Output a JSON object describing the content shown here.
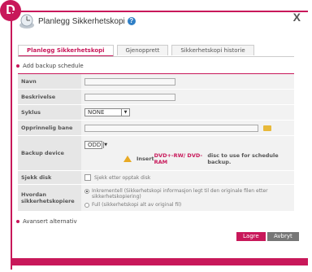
{
  "badge": "D",
  "dialog": {
    "title": "Planlegg Sikkerhetskopi",
    "help_icon": "?",
    "close_icon": "X"
  },
  "tabs": [
    {
      "label": "Planlegg Sikkerhetskopi",
      "active": true
    },
    {
      "label": "Gjenopprett",
      "active": false
    },
    {
      "label": "Sikkerhetskopi historie",
      "active": false
    }
  ],
  "section_add": "Add backup schedule",
  "fields": {
    "navn": {
      "label": "Navn",
      "value": ""
    },
    "beskrivelse": {
      "label": "Beskrivelse",
      "value": ""
    },
    "syklus": {
      "label": "Syklus",
      "value": "NONE"
    },
    "opprinnelig": {
      "label": "Opprinnelig bane",
      "value": ""
    },
    "backup_device": {
      "label": "Backup device",
      "value": "ODD",
      "warning_prefix": "Insert ",
      "warning_media": "DVD+-RW/ DVD-RAM",
      "warning_suffix": " disc to use for schedule backup."
    },
    "sjekk_disk": {
      "label": "Sjekk disk",
      "option": "Sjekk etter opptak disk",
      "checked": false
    },
    "hvordan": {
      "label": "Hvordan sikkerhetskopiere",
      "options": [
        {
          "text": "Inkrementell (Sikkerhetskopi informasjon legt til den originale filen etter sikkerhetskopiering)",
          "selected": true
        },
        {
          "text": "Full (sikkerhetskopi alt av original fil)",
          "selected": false
        }
      ]
    }
  },
  "section_advanced": "Avansert alternativ",
  "buttons": {
    "save": "Lagre",
    "cancel": "Avbryt"
  },
  "colors": {
    "accent": "#c8185a",
    "warning": "#e8a923",
    "folder": "#e8b93a"
  }
}
